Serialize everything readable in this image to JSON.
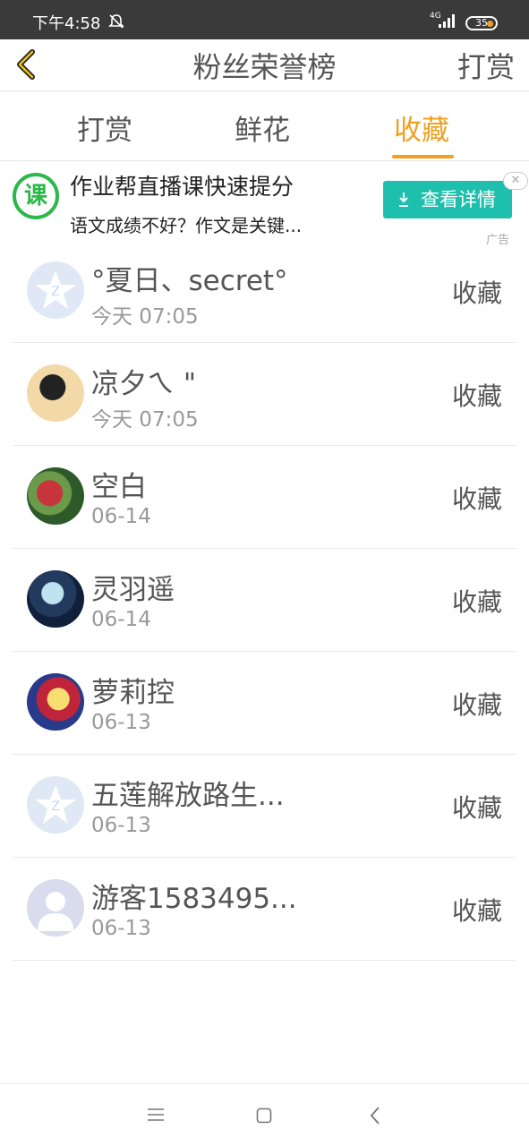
{
  "status_bar": {
    "time": "下午4:58",
    "network": "4G",
    "battery": "35"
  },
  "header": {
    "title": "粉丝荣誉榜",
    "action_label": "打赏"
  },
  "tabs": [
    {
      "label": "打赏",
      "active": false
    },
    {
      "label": "鲜花",
      "active": false
    },
    {
      "label": "收藏",
      "active": true
    }
  ],
  "ad": {
    "icon_char": "课",
    "title": "作业帮直播课快速提分",
    "description": "语文成绩不好？作文是关键...",
    "button_label": "查看详情",
    "close_glyph": "✕",
    "tag": "广告"
  },
  "fans": [
    {
      "name": "°夏日、secret°",
      "time": "今天 07:05",
      "action": "收藏",
      "avatar": "qq-default-icon"
    },
    {
      "name": "凉夕ㄟ \"",
      "time": "今天 07:05",
      "action": "收藏",
      "avatar": "user-photo"
    },
    {
      "name": "空白",
      "time": "06-14",
      "action": "收藏",
      "avatar": "user-photo"
    },
    {
      "name": "灵羽遥",
      "time": "06-14",
      "action": "收藏",
      "avatar": "user-photo"
    },
    {
      "name": "萝莉控",
      "time": "06-13",
      "action": "收藏",
      "avatar": "user-photo"
    },
    {
      "name": "五莲解放路生...",
      "time": "06-13",
      "action": "收藏",
      "avatar": "qq-default-icon"
    },
    {
      "name": "游客1583495...",
      "time": "06-13",
      "action": "收藏",
      "avatar": "guest-avatar-icon"
    }
  ],
  "colors": {
    "accent": "#f0a020",
    "ad_button": "#1fbfae",
    "ad_icon": "#2cb84a"
  }
}
